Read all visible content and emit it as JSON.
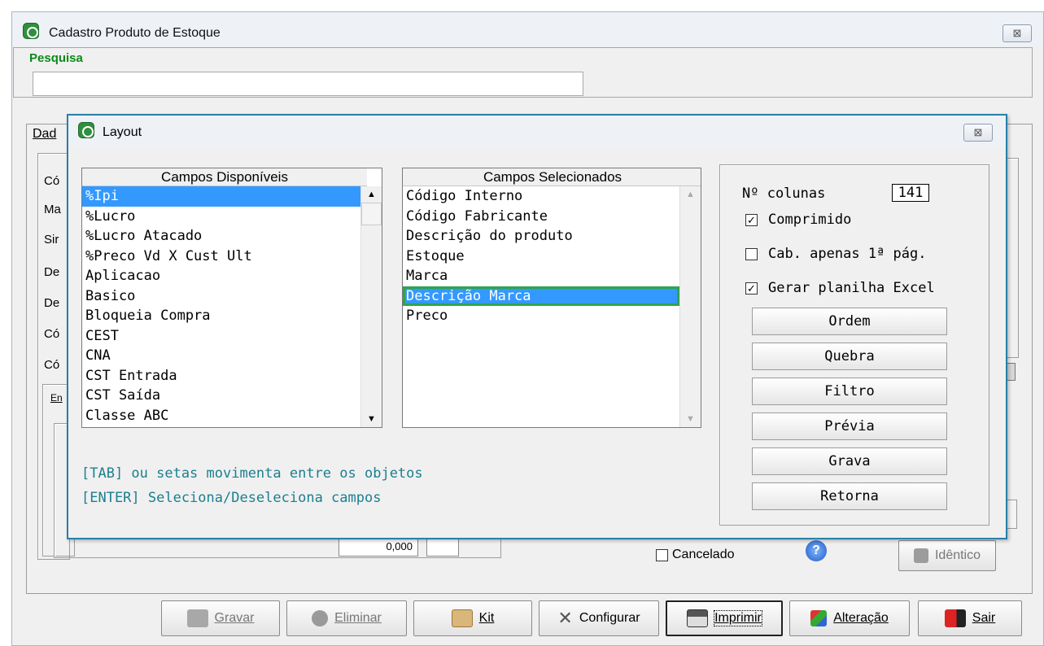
{
  "main_window": {
    "title": "Cadastro Produto de Estoque",
    "close_glyph": "⊠",
    "pesquisa_label": "Pesquisa",
    "search_value": "",
    "tab_label": "Dad",
    "stub_labels": [
      "Có",
      "Ma",
      "Sir",
      "De",
      "De",
      "Có",
      "Có"
    ],
    "sub_tab_label": "En",
    "checkbox_cancelado": "Cancelado",
    "partial_value": "0,000",
    "identico_label": "Idêntico",
    "toolbar": {
      "gravar": "Gravar",
      "eliminar": "Eliminar",
      "kit": "Kit",
      "configurar": "Configurar",
      "imprimir": "Imprimir",
      "alteracao": "Alteração",
      "sair": "Sair"
    }
  },
  "layout_dialog": {
    "title": "Layout",
    "close_glyph": "⊠",
    "available_header": "Campos Disponíveis",
    "available_fields": [
      "%Ipi",
      "%Lucro",
      "%Lucro Atacado",
      "%Preco Vd X Cust Ult",
      "Aplicacao",
      "Basico",
      "Bloqueia Compra",
      "CEST",
      "CNA",
      "CST Entrada",
      "CST Saída",
      "Classe ABC"
    ],
    "selected_header": "Campos Selecionados",
    "selected_fields": [
      "Código Interno",
      "Código Fabricante",
      "Descrição do produto",
      "Estoque",
      "Marca",
      "Descrição Marca",
      "Preco"
    ],
    "hint_line1": "[TAB] ou setas movimenta entre os objetos",
    "hint_line2": "[ENTER] Seleciona/Deseleciona campos",
    "num_colunas_label": "Nº colunas",
    "num_colunas_value": "141",
    "options": {
      "comprimido": "Comprimido",
      "cab_apenas": "Cab. apenas 1ª pág.",
      "gerar_excel": "Gerar planilha Excel"
    },
    "buttons": {
      "ordem": "Ordem",
      "quebra": "Quebra",
      "filtro": "Filtro",
      "previa": "Prévia",
      "grava": "Grava",
      "retorna": "Retorna"
    }
  }
}
